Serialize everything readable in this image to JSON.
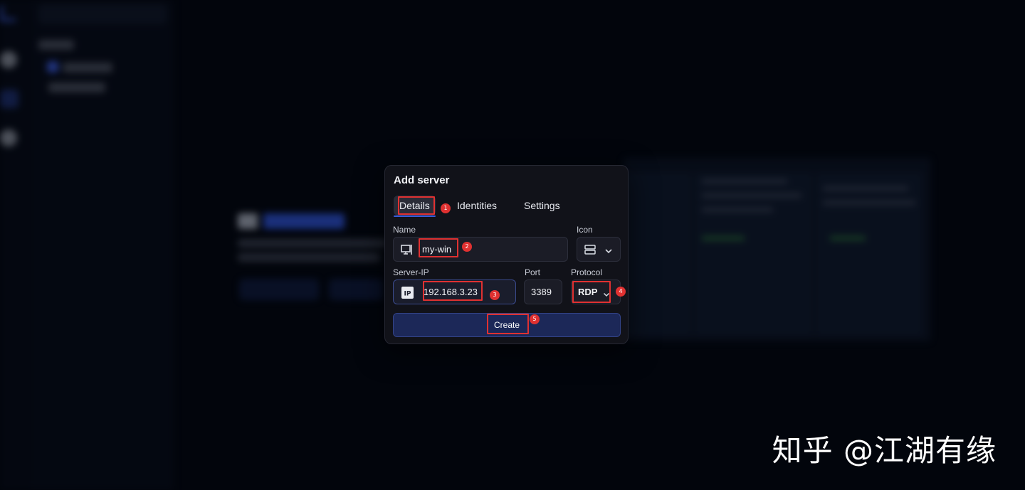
{
  "dialog": {
    "title": "Add server",
    "tabs": [
      {
        "label": "Details",
        "active": true
      },
      {
        "label": "Identities",
        "active": false
      },
      {
        "label": "Settings",
        "active": false
      }
    ],
    "name": {
      "label": "Name",
      "value": "my-win",
      "icon": "desktop-icon"
    },
    "icon_picker": {
      "label": "Icon",
      "icon": "server-icon"
    },
    "server_ip": {
      "label": "Server-IP",
      "value": "192.168.3.23",
      "icon": "ip-icon"
    },
    "port": {
      "label": "Port",
      "value": "3389"
    },
    "protocol": {
      "label": "Protocol",
      "value": "RDP",
      "options": [
        "RDP"
      ]
    },
    "create_label": "Create"
  },
  "annotations": [
    "1",
    "2",
    "3",
    "4",
    "5"
  ],
  "watermark": "知乎 @江湖有缘",
  "colors": {
    "accent": "#3b5bdb",
    "annotation_red": "#e03131",
    "dialog_bg": "#111219",
    "button_bg": "#1c2858"
  }
}
